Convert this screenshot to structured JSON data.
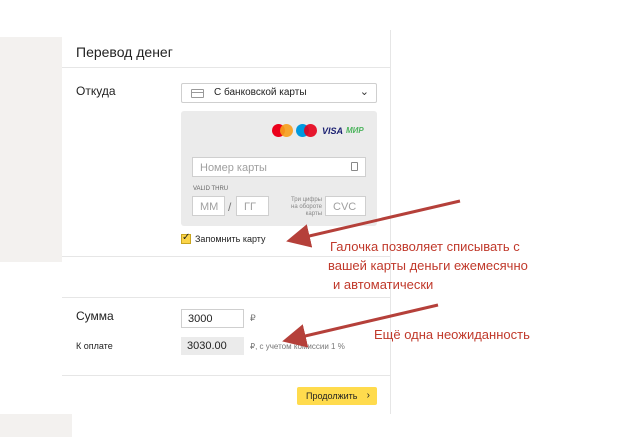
{
  "panel": {
    "title": "Перевод денег",
    "from_label": "Откуда",
    "source_select": {
      "value": "С банковской карты",
      "icon": "card-icon"
    },
    "payment_logos": [
      "Mastercard",
      "Maestro",
      "VISA",
      "МИР"
    ],
    "card_number": {
      "placeholder": "Номер карты"
    },
    "valid_thru": {
      "label": "VALID THRU",
      "month_placeholder": "ММ",
      "year_placeholder": "ГГ",
      "separator": "/"
    },
    "cvc": {
      "hint": "Три цифры на обороте карты",
      "placeholder": "CVC"
    },
    "remember": {
      "label": "Запомнить карту",
      "checked": true
    },
    "sum_label": "Сумма",
    "amount": {
      "value": "3000",
      "currency": "₽"
    },
    "to_pay": {
      "label": "К оплате",
      "value": "3030.00",
      "note": "₽, с учетом комиссии 1 %"
    },
    "continue_button": {
      "label": "Продолжить",
      "arrow": "›"
    }
  },
  "annotations": {
    "note1_lines": [
      "Галочка позволяет списывать с",
      "вашей карты деньги ежемесячно",
      "и автоматически"
    ],
    "note2": "Ещё одна неожиданность"
  },
  "colors": {
    "accent_yellow": "#ffdb4d",
    "annotation_red": "#c0392b",
    "arrow_red": "#b5403a"
  }
}
